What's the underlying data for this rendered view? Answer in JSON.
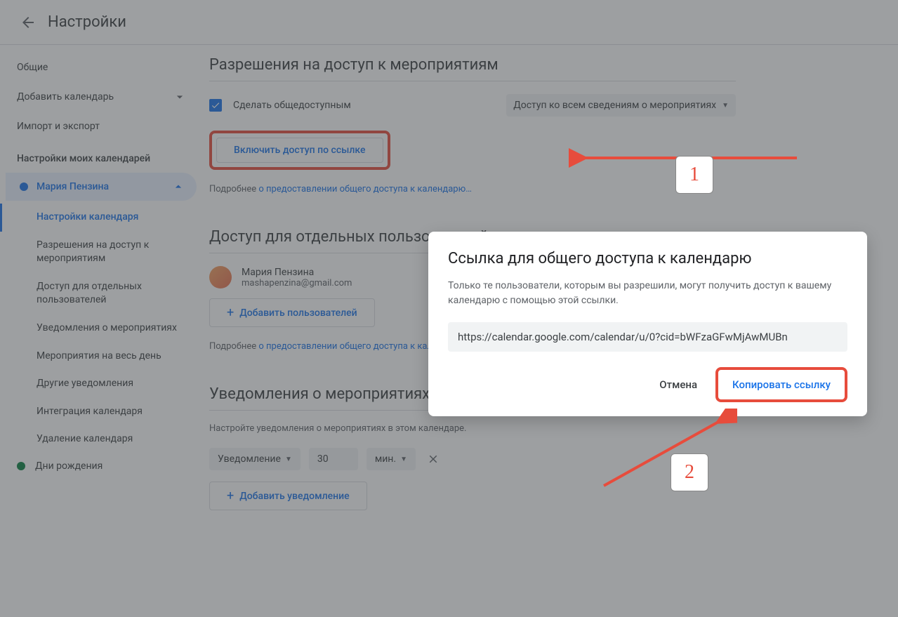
{
  "topbar": {
    "title": "Настройки"
  },
  "sidebar": {
    "general": "Общие",
    "add_calendar": "Добавить календарь",
    "import_export": "Импорт и экспорт",
    "my_calendars_header": "Настройки моих календарей",
    "calendar_name": "Мария Пензина",
    "sub": {
      "settings": "Настройки календаря",
      "permissions": "Разрешения на доступ к мероприятиям",
      "specific_users": "Доступ для отдельных пользователей",
      "event_notifications": "Уведомления о мероприятиях",
      "allday_events": "Мероприятия на весь день",
      "other_notifications": "Другие уведомления",
      "integrate": "Интеграция календаря",
      "delete": "Удаление календаря"
    },
    "birthdays": "Дни рождения",
    "birthdays_color": "#0b8043"
  },
  "permissions": {
    "title": "Разрешения на доступ к мероприятиям",
    "make_public": "Сделать общедоступным",
    "visibility_dropdown": "Доступ ко всем сведениям о мероприятиях",
    "shareable_link_btn": "Включить доступ по ссылке",
    "more_prefix": "Подробнее ",
    "more_link": "о предоставлении общего доступа к календарю…"
  },
  "access": {
    "title": "Доступ для отдельных пользователей",
    "user_name": "Мария Пензина",
    "user_email": "mashapenzina@gmail.com",
    "add_people": "Добавить пользователей",
    "more_prefix": "Подробнее ",
    "more_link": "о предоставлении общего доступа к календарю…"
  },
  "notifications": {
    "title": "Уведомления о мероприятиях",
    "desc": "Настройте уведомления о мероприятиях в этом календаре.",
    "type": "Уведомление",
    "value": "30",
    "unit": "мин.",
    "add_btn": "Добавить уведомление"
  },
  "modal": {
    "title": "Ссылка для общего доступа к календарю",
    "desc": "Только те пользователи, которым вы разрешили, могут получить доступ к вашему календарю с помощью этой ссылки.",
    "url": "https://calendar.google.com/calendar/u/0?cid=bWFzaGFwMjAwMUBn",
    "cancel": "Отмена",
    "copy": "Копировать ссылку"
  },
  "annotations": {
    "one": "1",
    "two": "2"
  }
}
